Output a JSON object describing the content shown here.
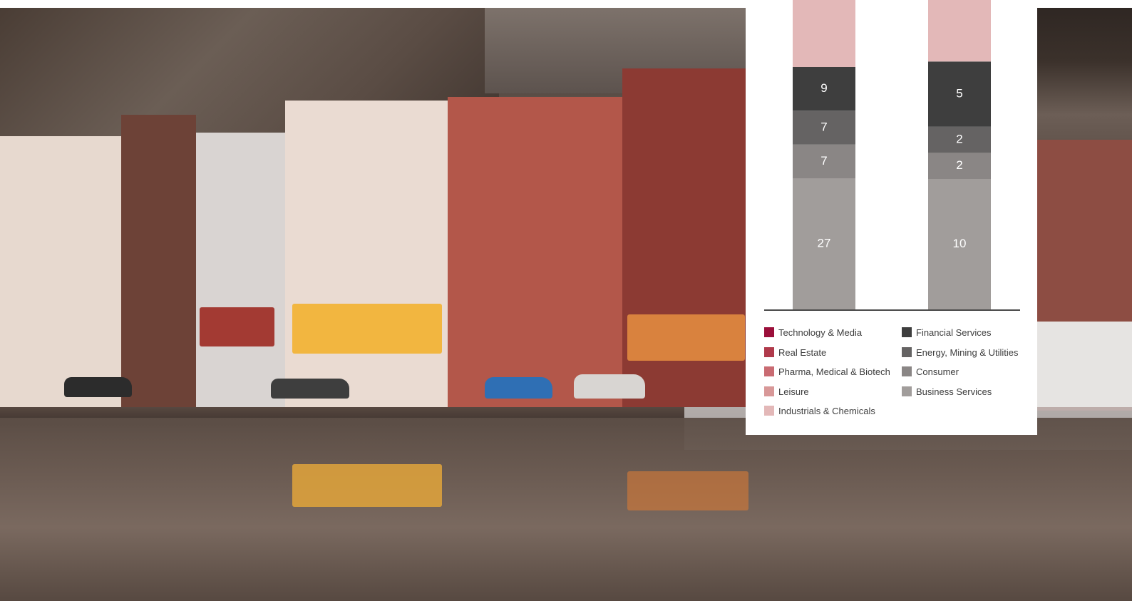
{
  "chart_data": {
    "type": "bar",
    "stacked": true,
    "categories": [
      "",
      ""
    ],
    "series": [
      {
        "name": "Business Services",
        "color": "#a19d9b",
        "values": [
          27,
          10
        ]
      },
      {
        "name": "Consumer",
        "color": "#8a8685",
        "values": [
          7,
          2
        ]
      },
      {
        "name": "Energy, Mining & Utilities",
        "color": "#656363",
        "values": [
          7,
          2
        ]
      },
      {
        "name": "Financial Services",
        "color": "#3e3e3e",
        "values": [
          9,
          5
        ]
      },
      {
        "name": "Industrials & Chemicals",
        "color": "#e3b8b8",
        "values": [
          null,
          null
        ]
      },
      {
        "name": "Leisure",
        "color": "#d89898",
        "values": [
          null,
          null
        ]
      },
      {
        "name": "Pharma, Medical & Biotech",
        "color": "#c96b72",
        "values": [
          null,
          null
        ]
      },
      {
        "name": "Real Estate",
        "color": "#b03a4b",
        "values": [
          null,
          null
        ]
      },
      {
        "name": "Technology & Media",
        "color": "#9b0f3a",
        "values": [
          null,
          null
        ]
      }
    ],
    "legend_placement": "bottom",
    "legend_columns": [
      [
        "Technology & Media",
        "Real Estate",
        "Pharma, Medical & Biotech",
        "Leisure",
        "Industrials & Chemicals"
      ],
      [
        "Financial Services",
        "Energy, Mining & Utilities",
        "Consumer",
        "Business Services"
      ]
    ],
    "grid": false
  }
}
